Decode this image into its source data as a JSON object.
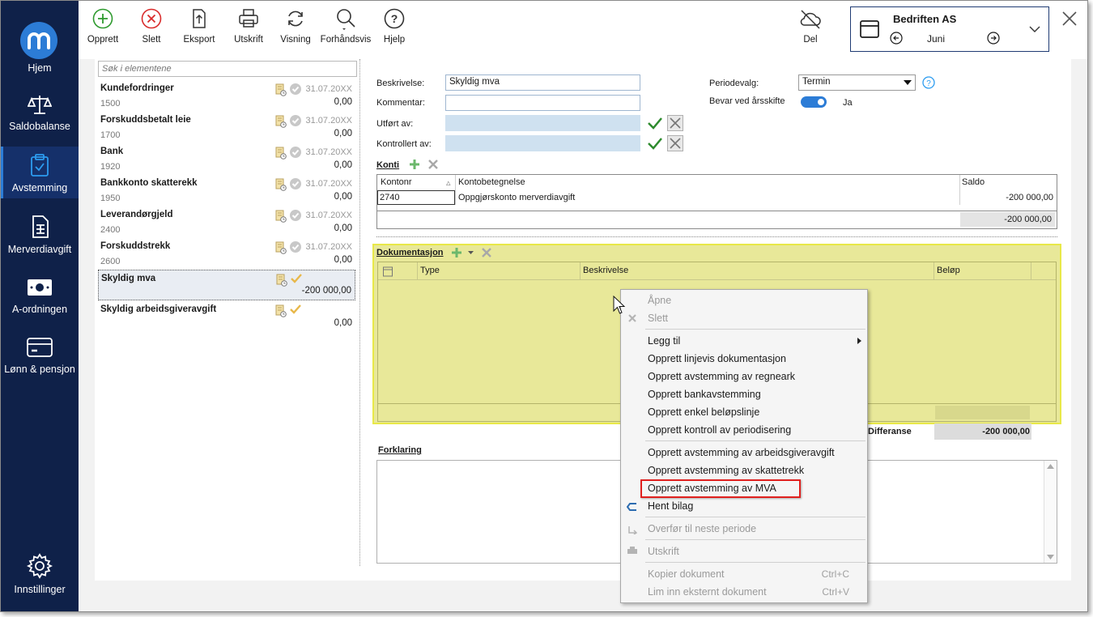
{
  "nav": {
    "items": [
      {
        "label": "Hjem",
        "icon": "home-logo"
      },
      {
        "label": "Saldobalanse",
        "icon": "scale-icon"
      },
      {
        "label": "Avstemming",
        "icon": "clipboard-check-icon"
      },
      {
        "label": "Merverdiavgift",
        "icon": "document-icon"
      },
      {
        "label": "A-ordningen",
        "icon": "money-icon"
      },
      {
        "label": "Lønn & pensjon",
        "icon": "card-icon"
      },
      {
        "label": "Innstillinger",
        "icon": "gear-icon"
      }
    ]
  },
  "toolbar": {
    "opprett": "Opprett",
    "slett": "Slett",
    "eksport": "Eksport",
    "utskrift": "Utskrift",
    "visning": "Visning",
    "forhandsvis": "Forhåndsvis",
    "hjelp": "Hjelp",
    "del": "Del"
  },
  "company": {
    "name": "Bedriften AS",
    "month": "Juni"
  },
  "search": {
    "placeholder": "Søk i elementene"
  },
  "accounts": [
    {
      "name": "Kundefordringer",
      "number": "1500",
      "date": "31.07.20XX",
      "amount": "0,00"
    },
    {
      "name": "Forskuddsbetalt leie",
      "number": "1700",
      "date": "31.07.20XX",
      "amount": "0,00"
    },
    {
      "name": "Bank",
      "number": "1920",
      "date": "31.07.20XX",
      "amount": "0,00"
    },
    {
      "name": "Bankkonto skatterekk",
      "number": "1950",
      "date": "31.07.20XX",
      "amount": "0,00"
    },
    {
      "name": "Leverandørgjeld",
      "number": "2400",
      "date": "31.07.20XX",
      "amount": "0,00"
    },
    {
      "name": "Forskuddstrekk",
      "number": "2600",
      "date": "31.07.20XX",
      "amount": "0,00"
    },
    {
      "name": "Skyldig mva",
      "number": "",
      "date": "",
      "amount": "-200 000,00"
    },
    {
      "name": "Skyldig arbeidsgiveravgift",
      "number": "",
      "date": "",
      "amount": "0,00"
    }
  ],
  "form": {
    "beskrivelse_label": "Beskrivelse:",
    "beskrivelse_value": "Skyldig mva",
    "kommentar_label": "Kommentar:",
    "utfort_label": "Utført av:",
    "kontrollert_label": "Kontrollert av:",
    "periodevalg_label": "Periodevalg:",
    "periodevalg_value": "Termin",
    "bevar_label": "Bevar ved årsskifte",
    "bevar_value": "Ja"
  },
  "konti": {
    "title": "Konti",
    "headers": [
      "Kontonr",
      "Kontobetegnelse",
      "Saldo"
    ],
    "row": {
      "kontonr": "2740",
      "betegnelse": "Oppgjørskonto merverdiavgift",
      "saldo": "-200 000,00"
    },
    "total": "-200 000,00"
  },
  "dokumentasjon": {
    "title": "Dokumentasjon",
    "headers": [
      "Type",
      "Beskrivelse",
      "Beløp"
    ],
    "differanse_label": "Differanse",
    "differanse_value": "-200 000,00"
  },
  "forklaring": {
    "title": "Forklaring"
  },
  "context_menu": {
    "apne": "Åpne",
    "slett": "Slett",
    "legg_til": "Legg til",
    "linjevis": "Opprett linjevis dokumentasjon",
    "regneark": "Opprett avstemming av regneark",
    "bank": "Opprett bankavstemming",
    "belop": "Opprett enkel beløpslinje",
    "periodisering": "Opprett kontroll av periodisering",
    "arbeidsgiveravgift": "Opprett avstemming av arbeidsgiveravgift",
    "skattetrekk": "Opprett avstemming av skattetrekk",
    "mva": "Opprett avstemming av MVA",
    "hent_bilag": "Hent bilag",
    "overfor": "Overfør til neste periode",
    "utskrift": "Utskrift",
    "kopier": "Kopier dokument",
    "kopier_short": "Ctrl+C",
    "lim_inn": "Lim inn eksternt dokument",
    "lim_inn_short": "Ctrl+V"
  }
}
